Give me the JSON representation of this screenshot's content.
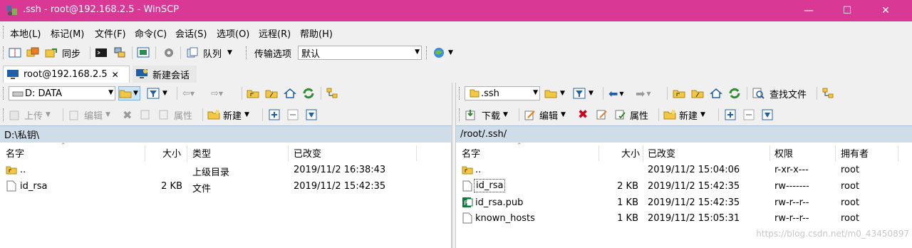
{
  "window": {
    "title": ".ssh - root@192.168.2.5 - WinSCP",
    "title_color": "#d93894",
    "controls": [
      "minimize-icon",
      "maximize-icon",
      "close-icon"
    ]
  },
  "menu": [
    "本地(L)",
    "标记(M)",
    "文件(F)",
    "命令(C)",
    "会话(S)",
    "选项(O)",
    "远程(R)",
    "帮助(H)"
  ],
  "toolbar": {
    "sync_label": "同步",
    "queue_label": "队列",
    "transfer_options_label": "传输选项",
    "transfer_preset_value": "默认"
  },
  "tabs": {
    "session_tab": "root@192.168.2.5",
    "new_session_tab": "新建会话"
  },
  "left_panel": {
    "drive_value": "D: DATA",
    "upload_label": "上传",
    "edit_label": "编辑",
    "properties_label": "属性",
    "new_label": "新建",
    "path": "D:\\私钥\\",
    "columns": [
      "名字",
      "大小",
      "类型",
      "已改变"
    ],
    "rows": [
      {
        "name": "..",
        "size": "",
        "type": "上级目录",
        "changed": "2019/11/2  16:38:43"
      },
      {
        "name": "id_rsa",
        "size": "2 KB",
        "type": "文件",
        "changed": "2019/11/2  15:42:35"
      }
    ]
  },
  "right_panel": {
    "folder_value": ".ssh",
    "download_label": "下载",
    "edit_label": "编辑",
    "properties_label": "属性",
    "new_label": "新建",
    "find_files_label": "查找文件",
    "path": "/root/.ssh/",
    "columns": [
      "名字",
      "大小",
      "已改变",
      "权限",
      "拥有者"
    ],
    "rows": [
      {
        "name": "..",
        "size": "",
        "changed": "2019/11/2  15:04:06",
        "rights": "r-xr-x---",
        "owner": "root"
      },
      {
        "name": "id_rsa",
        "size": "2 KB",
        "changed": "2019/11/2  15:42:35",
        "rights": "rw-------",
        "owner": "root"
      },
      {
        "name": "id_rsa.pub",
        "size": "1 KB",
        "changed": "2019/11/2  15:42:35",
        "rights": "rw-r--r--",
        "owner": "root"
      },
      {
        "name": "known_hosts",
        "size": "1 KB",
        "changed": "2019/11/2  15:05:31",
        "rights": "rw-r--r--",
        "owner": "root"
      }
    ]
  },
  "watermark": "https://blog.csdn.net/m0_43450897"
}
